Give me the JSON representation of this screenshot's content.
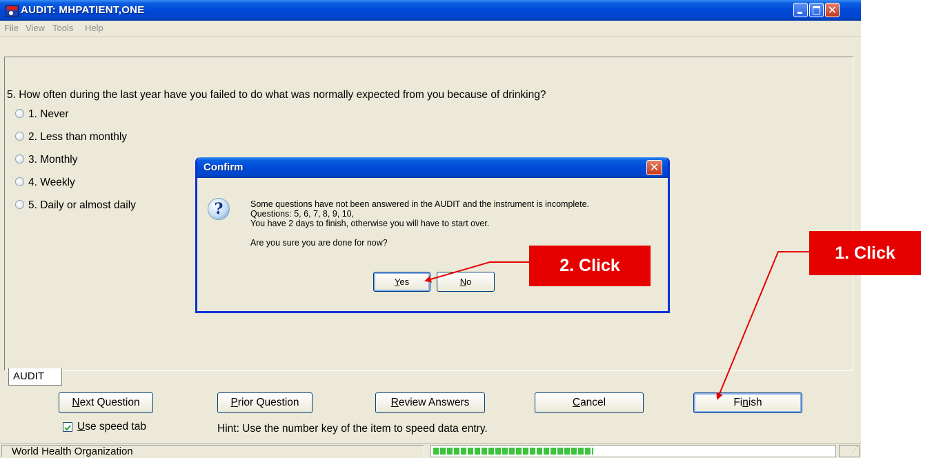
{
  "window": {
    "title": "AUDIT: MHPATIENT,ONE",
    "menu": [
      "File",
      "View",
      "Tools",
      "Help"
    ],
    "caption_buttons": [
      "minimize-icon",
      "maximize-icon",
      "close-icon"
    ]
  },
  "question": {
    "text": "5. How often during the last year have you failed to do what was normally expected from you because of drinking?",
    "options": [
      "1. Never",
      "2. Less than monthly",
      "3. Monthly",
      "4. Weekly",
      "5. Daily or almost daily"
    ]
  },
  "tab": {
    "label": "AUDIT"
  },
  "buttons": {
    "next": {
      "label": "Next Question",
      "mnemonic": "N"
    },
    "prior": {
      "label": "Prior Question",
      "mnemonic": "P"
    },
    "review": {
      "label": "Review Answers",
      "mnemonic": "R"
    },
    "cancel": {
      "label": "Cancel",
      "mnemonic": "C"
    },
    "finish": {
      "label": "Finish",
      "mnemonic": "n"
    }
  },
  "speed_tab": {
    "label": "Use speed tab",
    "checked": true
  },
  "hint": "Hint: Use the number key of the item to speed data entry.",
  "status": {
    "text": "World Health Organization",
    "progress_fraction": 0.4
  },
  "dialog": {
    "title": "Confirm",
    "icon": "question-icon",
    "lines": [
      "Some questions have not been answered in the AUDIT and the instrument is incomplete.",
      "Questions: 5, 6, 7, 8, 9, 10,",
      "You have 2 days to finish, otherwise you will have to start over.",
      "Are you sure you are done for now?"
    ],
    "yes": "Yes",
    "no": "No"
  },
  "callouts": {
    "step1": "1. Click",
    "step2": "2. Click"
  },
  "colors": {
    "callout": "#e60000",
    "title_bar": "#0049d8",
    "progress": "#3cc43c"
  }
}
